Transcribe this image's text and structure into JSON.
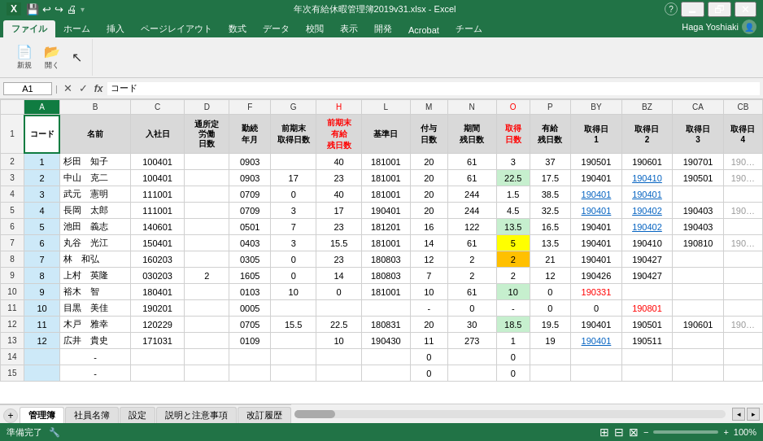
{
  "titlebar": {
    "filename": "年次有給休暇管理簿2019v31.xlsx - Excel",
    "question_icon": "?",
    "minimize": "🗕",
    "restore": "🗗",
    "close": "✕"
  },
  "quick_access": [
    "💾",
    "↩",
    "↪",
    "🖨",
    "↗"
  ],
  "ribbon_tabs": [
    "ファイル",
    "ホーム",
    "挿入",
    "ページレイアウト",
    "数式",
    "データ",
    "校閲",
    "表示",
    "開発",
    "Acrobat",
    "チーム"
  ],
  "active_tab": "ファイル",
  "user": "Haga Yoshiaki",
  "formula_bar": {
    "cell_ref": "A1",
    "formula": "コード"
  },
  "column_headers": [
    "A",
    "B",
    "C",
    "D",
    "F",
    "G",
    "H",
    "L",
    "M",
    "N",
    "O",
    "P",
    "BY",
    "BZ",
    "CA",
    "CB"
  ],
  "header_row1": [
    "コード",
    "名前",
    "入社日",
    "通所定労働日数",
    "勤続年月",
    "前期末取得日数",
    "前期末有給残日数",
    "基準日",
    "付与日数",
    "期間残日数",
    "取得日数",
    "有給残日数",
    "取得日1",
    "取得日2",
    "取得日3",
    "取得日4"
  ],
  "rows": [
    {
      "row": "1",
      "A": "コード",
      "B": "名前",
      "C": "入社日",
      "D": "通所定労働日数",
      "F": "勤続年月",
      "G": "前期末取得日数",
      "H": "前期末有給残日数",
      "L": "基準日",
      "M": "付与日数",
      "N": "期間残日数",
      "O": "取得日数",
      "P": "有給残日数",
      "BY": "取得日1",
      "BZ": "取得日2",
      "CA": "取得日3",
      "CB": "取得日4"
    },
    {
      "row": "2",
      "A": "1",
      "B": "杉田　知子",
      "C": "100401",
      "D": "",
      "F": "0903",
      "G": "",
      "H": "40",
      "L": "181001",
      "M": "20",
      "N": "61",
      "O": "3",
      "P": "37",
      "BY": "190501",
      "BZ": "190601",
      "CA": "190701",
      "CB": "190..."
    },
    {
      "row": "3",
      "A": "2",
      "B": "中山　克二",
      "C": "100401",
      "D": "",
      "F": "0903",
      "G": "17",
      "H": "23",
      "L": "181001",
      "M": "20",
      "N": "61",
      "O": "22.5",
      "P": "17.5",
      "BY": "190401",
      "BZ": "190410",
      "CA": "190501",
      "CB": "190..."
    },
    {
      "row": "4",
      "A": "3",
      "B": "武元　憲明",
      "C": "111001",
      "D": "",
      "F": "0709",
      "G": "0",
      "H": "40",
      "L": "181001",
      "M": "20",
      "N": "244",
      "O": "1.5",
      "P": "38.5",
      "BY": "190401",
      "BZ": "190401",
      "CA": "",
      "CB": ""
    },
    {
      "row": "5",
      "A": "4",
      "B": "長岡　太郎",
      "C": "111001",
      "D": "",
      "F": "0709",
      "G": "3",
      "H": "17",
      "L": "190401",
      "M": "20",
      "N": "244",
      "O": "4.5",
      "P": "32.5",
      "BY": "190401",
      "BZ": "190402",
      "CA": "190403",
      "CB": "190..."
    },
    {
      "row": "6",
      "A": "5",
      "B": "池田　義志",
      "C": "140601",
      "D": "",
      "F": "0501",
      "G": "7",
      "H": "23",
      "L": "181201",
      "M": "16",
      "N": "122",
      "O": "13.5",
      "P": "16.5",
      "BY": "190401",
      "BZ": "190402",
      "CA": "190403",
      "CB": ""
    },
    {
      "row": "7",
      "A": "6",
      "B": "丸谷　光江",
      "C": "150401",
      "D": "",
      "F": "0403",
      "G": "3",
      "H": "15.5",
      "L": "181001",
      "M": "14",
      "N": "61",
      "O": "5",
      "P": "13.5",
      "BY": "190401",
      "BZ": "190410",
      "CA": "190810",
      "CB": "190..."
    },
    {
      "row": "8",
      "A": "7",
      "B": "林　和弘",
      "C": "160203",
      "D": "",
      "F": "0305",
      "G": "0",
      "H": "23",
      "L": "180803",
      "M": "12",
      "N": "2",
      "O": "2",
      "P": "21",
      "BY": "190401",
      "BZ": "190427",
      "CA": "",
      "CB": ""
    },
    {
      "row": "9",
      "A": "8",
      "B": "上村　英隆",
      "C": "030203",
      "D": "2",
      "F": "1605",
      "G": "0",
      "H": "14",
      "L": "180803",
      "M": "7",
      "N": "2",
      "O": "2",
      "P": "12",
      "BY": "190426",
      "BZ": "190427",
      "CA": "",
      "CB": ""
    },
    {
      "row": "10",
      "A": "9",
      "B": "裕木　智",
      "C": "180401",
      "D": "",
      "F": "0103",
      "G": "10",
      "H": "0",
      "L": "181001",
      "M": "10",
      "N": "61",
      "O": "10",
      "P": "0",
      "BY": "190331",
      "BZ": "",
      "CA": "",
      "CB": ""
    },
    {
      "row": "11",
      "A": "10",
      "B": "目黒　美佳",
      "C": "190201",
      "D": "",
      "F": "0005",
      "G": "",
      "H": "",
      "L": "",
      "M": "-",
      "N": "0",
      "O": "-",
      "P": "0",
      "BY": "0",
      "BZ": "190801",
      "CA": "",
      "CB": ""
    },
    {
      "row": "12",
      "A": "11",
      "B": "木戸　雅幸",
      "C": "120229",
      "D": "",
      "F": "0705",
      "G": "15.5",
      "H": "22.5",
      "L": "180831",
      "M": "20",
      "N": "30",
      "O": "18.5",
      "P": "19.5",
      "BY": "190401",
      "BZ": "190501",
      "CA": "190601",
      "CB": "190..."
    },
    {
      "row": "13",
      "A": "12",
      "B": "広井　貴史",
      "C": "171031",
      "D": "",
      "F": "0109",
      "G": "",
      "H": "10",
      "L": "190430",
      "M": "11",
      "N": "273",
      "O": "1",
      "P": "19",
      "BY": "190401",
      "BZ": "190511",
      "CA": "",
      "CB": ""
    },
    {
      "row": "14",
      "A": "",
      "B": "-",
      "C": "",
      "D": "",
      "F": "",
      "G": "",
      "H": "",
      "L": "",
      "M": "0",
      "N": "",
      "O": "0",
      "P": "",
      "BY": "",
      "BZ": "",
      "CA": "",
      "CB": ""
    },
    {
      "row": "15",
      "A": "",
      "B": "-",
      "C": "",
      "D": "",
      "F": "",
      "G": "",
      "H": "",
      "L": "",
      "M": "0",
      "N": "",
      "O": "0",
      "P": "",
      "BY": "",
      "BZ": "",
      "CA": "",
      "CB": ""
    }
  ],
  "special_cells": {
    "O3": {
      "style": "green-bg",
      "value": "22.5"
    },
    "O6": {
      "style": "green-bg",
      "value": "13.5"
    },
    "O7": {
      "style": "yellow-bg",
      "value": "5"
    },
    "O8": {
      "style": "orange-bg",
      "value": "2"
    },
    "O10": {
      "style": "green-bg",
      "value": "10"
    },
    "O12": {
      "style": "green-bg",
      "value": "18.5"
    },
    "BY10": {
      "style": "red-text",
      "value": "190331"
    },
    "BZ11": {
      "style": "red-text",
      "value": "190801"
    },
    "BZ5": {
      "style": "underline",
      "value": "190402"
    },
    "CA5": {
      "style": "underline",
      "value": ""
    },
    "BY5": {
      "style": "underline",
      "value": "190401"
    },
    "BY4": {
      "style": "underline",
      "value": "190401"
    }
  },
  "sheet_tabs": [
    "管理簿",
    "社員名簿",
    "設定",
    "説明と注意事項",
    "改訂履歴"
  ],
  "active_sheet": "管理簿",
  "status": {
    "ready": "準備完了",
    "zoom": "100%"
  }
}
